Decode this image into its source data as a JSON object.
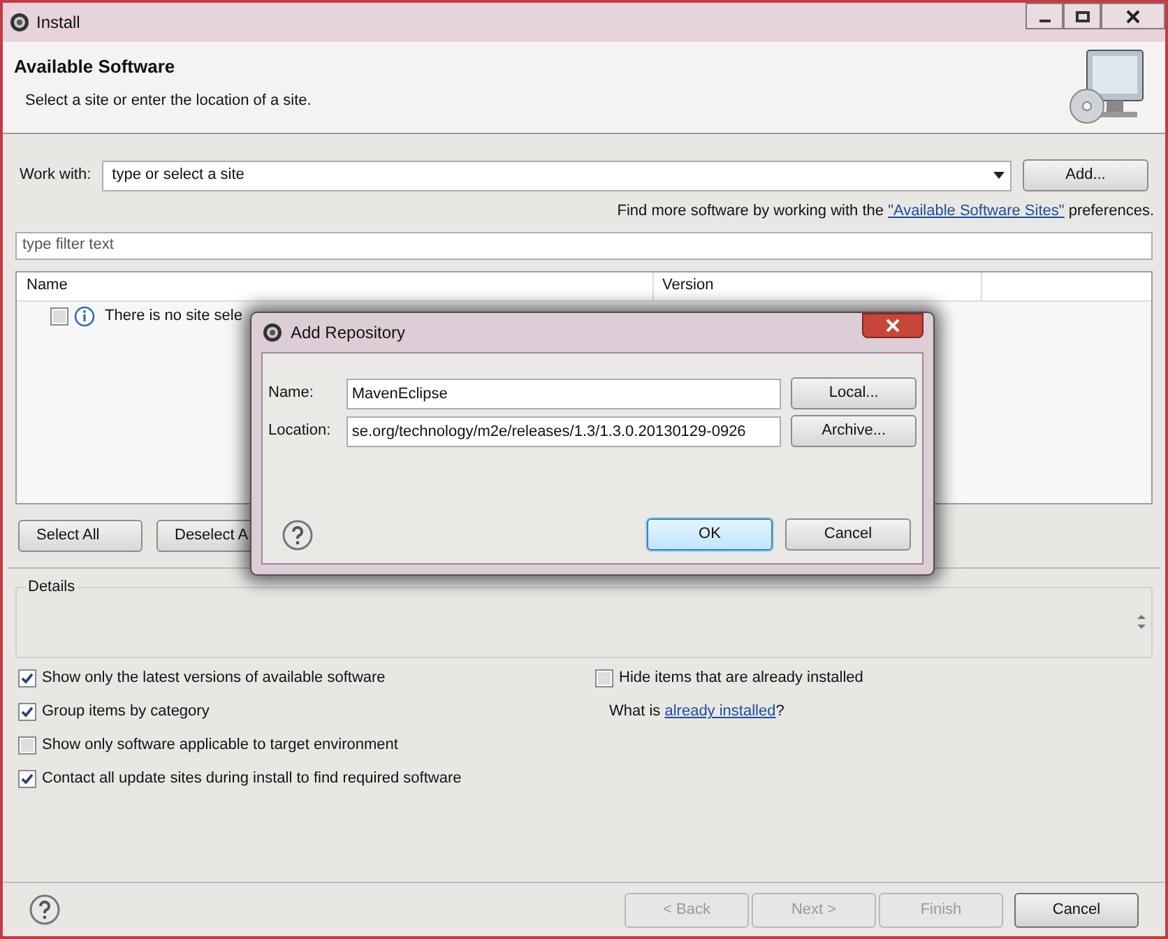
{
  "window": {
    "title": "Install"
  },
  "header": {
    "title": "Available Software",
    "subtitle": "Select a site or enter the location of a site."
  },
  "work_with": {
    "label": "Work with:",
    "placeholder": "type or select a site",
    "add_button": "Add..."
  },
  "find_more": {
    "prefix": "Find more software by working with the",
    "link": "\"Available Software Sites\"",
    "suffix": "preferences."
  },
  "filter": {
    "placeholder": "type filter text"
  },
  "table": {
    "columns": [
      "Name",
      "Version"
    ],
    "rows": [
      {
        "text": "There is no site sele",
        "checked": false
      }
    ]
  },
  "table_buttons": [
    "Select All",
    "Deselect A"
  ],
  "details": {
    "title": "Details"
  },
  "options_left": [
    {
      "label": "Show only the latest versions of available software",
      "checked": true
    },
    {
      "label": "Group items by category",
      "checked": true
    },
    {
      "label": "Show only software applicable to target environment",
      "checked": false
    },
    {
      "label": "Contact all update sites during install to find required software",
      "checked": true
    }
  ],
  "options_right": [
    {
      "label": "Hide items that are already installed",
      "checked": false
    }
  ],
  "installed_note": {
    "prefix": "What is",
    "link": "already installed",
    "suffix": "?"
  },
  "footer_buttons": [
    {
      "label": "< Back",
      "disabled": true
    },
    {
      "label": "Next >",
      "disabled": true
    },
    {
      "label": "Finish",
      "disabled": true
    },
    {
      "label": "Cancel",
      "disabled": false
    }
  ],
  "dialog": {
    "title": "Add Repository",
    "fields": [
      {
        "label": "Name:",
        "value": "MavenEclipse",
        "button": "Local..."
      },
      {
        "label": "Location:",
        "value": "se.org/technology/m2e/releases/1.3/1.3.0.20130129-0926",
        "button": "Archive..."
      }
    ],
    "buttons": [
      {
        "label": "OK",
        "selected": true
      },
      {
        "label": "Cancel",
        "selected": false
      }
    ]
  }
}
